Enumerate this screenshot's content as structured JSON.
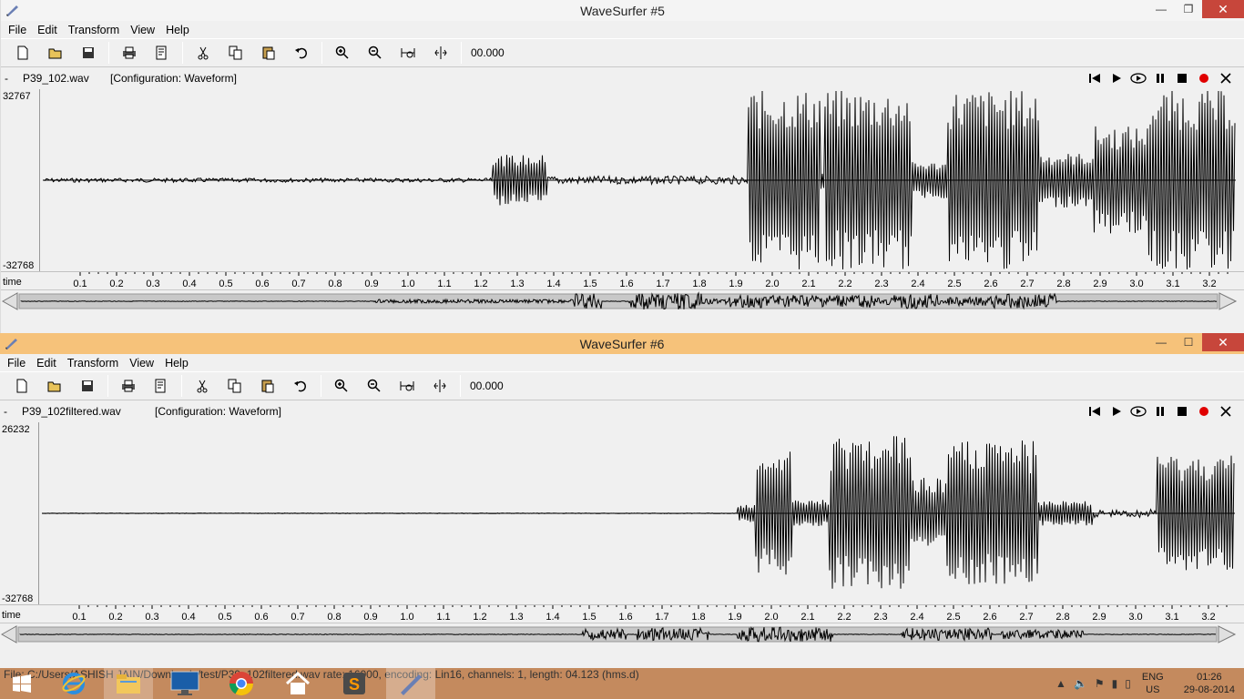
{
  "window5": {
    "title": "WaveSurfer #5",
    "menu": [
      "File",
      "Edit",
      "Transform",
      "View",
      "Help"
    ],
    "time_field": "00.000",
    "file_dash": "-",
    "filename": "P39_102.wav",
    "configuration": "[Configuration: Waveform]",
    "y_max": "32767",
    "y_min": "-32768",
    "time_label": "time"
  },
  "window6": {
    "title": "WaveSurfer #6",
    "menu": [
      "File",
      "Edit",
      "Transform",
      "View",
      "Help"
    ],
    "time_field": "00.000",
    "file_dash": "-",
    "filename": "P39_102filtered.wav",
    "configuration": "[Configuration: Waveform]",
    "y_max": "26232",
    "y_min": "-32768",
    "time_label": "time"
  },
  "time_ticks": [
    "0.1",
    "0.2",
    "0.3",
    "0.4",
    "0.5",
    "0.6",
    "0.7",
    "0.8",
    "0.9",
    "1.0",
    "1.1",
    "1.2",
    "1.3",
    "1.4",
    "1.5",
    "1.6",
    "1.7",
    "1.8",
    "1.9",
    "2.0",
    "2.1",
    "2.2",
    "2.3",
    "2.4",
    "2.5",
    "2.6",
    "2.7",
    "2.8",
    "2.9",
    "3.0",
    "3.1",
    "3.2"
  ],
  "status_bar": "File: C:/Users/ASHISH JAIN/Downloads/test/P39_102filtered.wav   rate: 16000, encoding: Lin16, channels: 1, length: 04.123 (hms.d)",
  "tray": {
    "lang_top": "ENG",
    "lang_bottom": "US",
    "time": "01:26",
    "date": "29-08-2014"
  },
  "toolbar_icons": [
    "new-icon",
    "open-icon",
    "save-icon",
    "print-icon",
    "properties-icon",
    "cut-icon",
    "copy-icon",
    "paste-icon",
    "undo-icon",
    "zoom-in-icon",
    "zoom-out-icon",
    "zoom-all-icon",
    "zoom-selection-icon"
  ],
  "transport_icons": [
    "skip-start-icon",
    "play-icon",
    "play-loop-icon",
    "pause-icon",
    "stop-icon",
    "record-icon",
    "close-icon"
  ],
  "colors": {
    "title_active": "#f6c27a",
    "close_button": "#c7463b",
    "taskbar": "#c48a5e",
    "record": "#e00000"
  }
}
